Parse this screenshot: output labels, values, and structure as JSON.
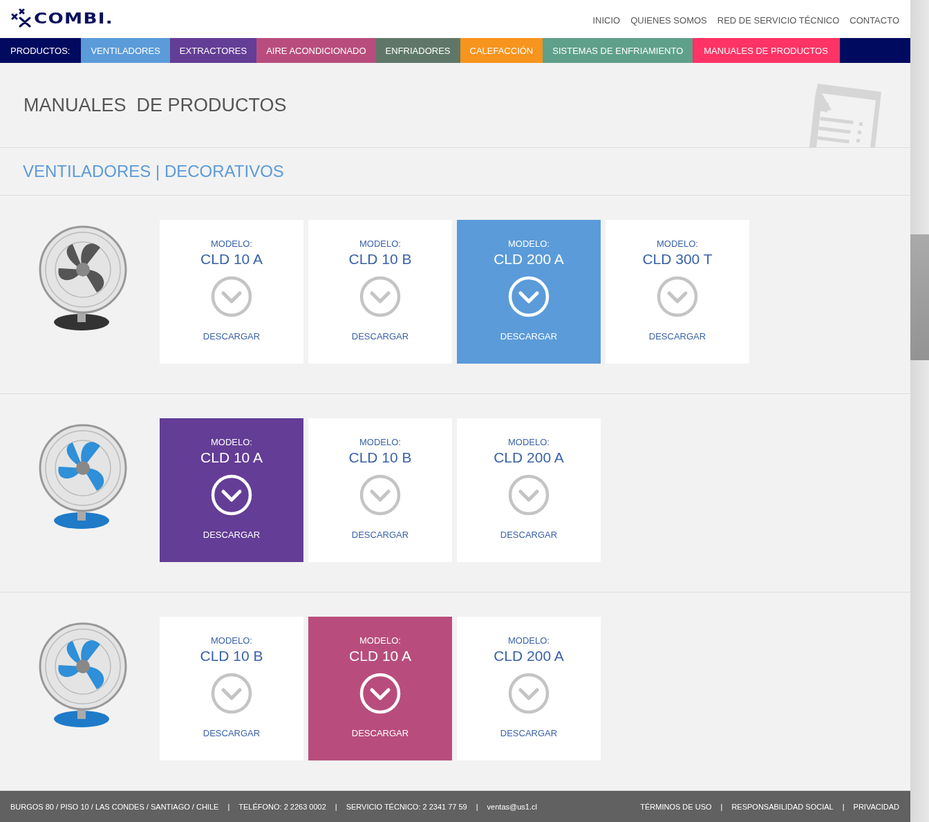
{
  "header": {
    "logo": "COMBI.",
    "links": [
      "INICIO",
      "QUIENES SOMOS",
      "RED DE SERVICIO TÉCNICO",
      "CONTACTO"
    ]
  },
  "nav": {
    "label": "PRODUCTOS:",
    "items": [
      {
        "label": "VENTILADORES",
        "color": "#5b9bd9",
        "selected": false
      },
      {
        "label": "EXTRACTORES",
        "color": "#643d96",
        "selected": false
      },
      {
        "label": "AIRE ACONDICIONADO",
        "color": "#b84d7d",
        "selected": false
      },
      {
        "label": "ENFRIADORES",
        "color": "#5f7769",
        "selected": false
      },
      {
        "label": "CALEFACCIÓN",
        "color": "#f7941d",
        "selected": false
      },
      {
        "label": "SISTEMAS DE ENFRIAMIENTO",
        "color": "#5fa08a",
        "selected": false
      },
      {
        "label": "MANUALES DE PRODUCTOS",
        "color": "#ff3366",
        "selected": true
      }
    ]
  },
  "page_title": "MANUALES  DE PRODUCTOS",
  "section_title": "VENTILADORES | DECORATIVOS",
  "groups": [
    {
      "kind": "black",
      "color": "#5b9bd9",
      "cards": [
        {
          "label": "MODELO:",
          "model": "CLD 10 A",
          "action": "DESCARGAR",
          "selected": false
        },
        {
          "label": "MODELO:",
          "model": "CLD 10 B",
          "action": "DESCARGAR",
          "selected": false
        },
        {
          "label": "MODELO:",
          "model": "CLD 200 A",
          "action": "DESCARGAR",
          "selected": true
        },
        {
          "label": "MODELO:",
          "model": "CLD 300 T",
          "action": "DESCARGAR",
          "selected": false
        }
      ]
    },
    {
      "kind": "blue",
      "color": "#643d96",
      "cards": [
        {
          "label": "MODELO:",
          "model": "CLD 10 A",
          "action": "DESCARGAR",
          "selected": true
        },
        {
          "label": "MODELO:",
          "model": "CLD 10 B",
          "action": "DESCARGAR",
          "selected": false
        },
        {
          "label": "MODELO:",
          "model": "CLD 200 A",
          "action": "DESCARGAR",
          "selected": false
        }
      ]
    },
    {
      "kind": "blue",
      "color": "#b84d7d",
      "cards": [
        {
          "label": "MODELO:",
          "model": "CLD 10 B",
          "action": "DESCARGAR",
          "selected": false
        },
        {
          "label": "MODELO:",
          "model": "CLD 10 A",
          "action": "DESCARGAR",
          "selected": true
        },
        {
          "label": "MODELO:",
          "model": "CLD 200 A",
          "action": "DESCARGAR",
          "selected": false
        }
      ]
    }
  ],
  "footer": {
    "separator": "|",
    "left": [
      "BURGOS 80 / PISO 10 / LAS CONDES / SANTIAGO / CHILE",
      "TELÉFONO: 2 2263 0002",
      "SERVICIO TÉCNICO: 2 2341 77 59",
      "ventas@us1.cl"
    ],
    "right": [
      "TÉRMINOS DE USO",
      "RESPONSABILIDAD SOCIAL",
      "PRIVACIDAD"
    ]
  }
}
